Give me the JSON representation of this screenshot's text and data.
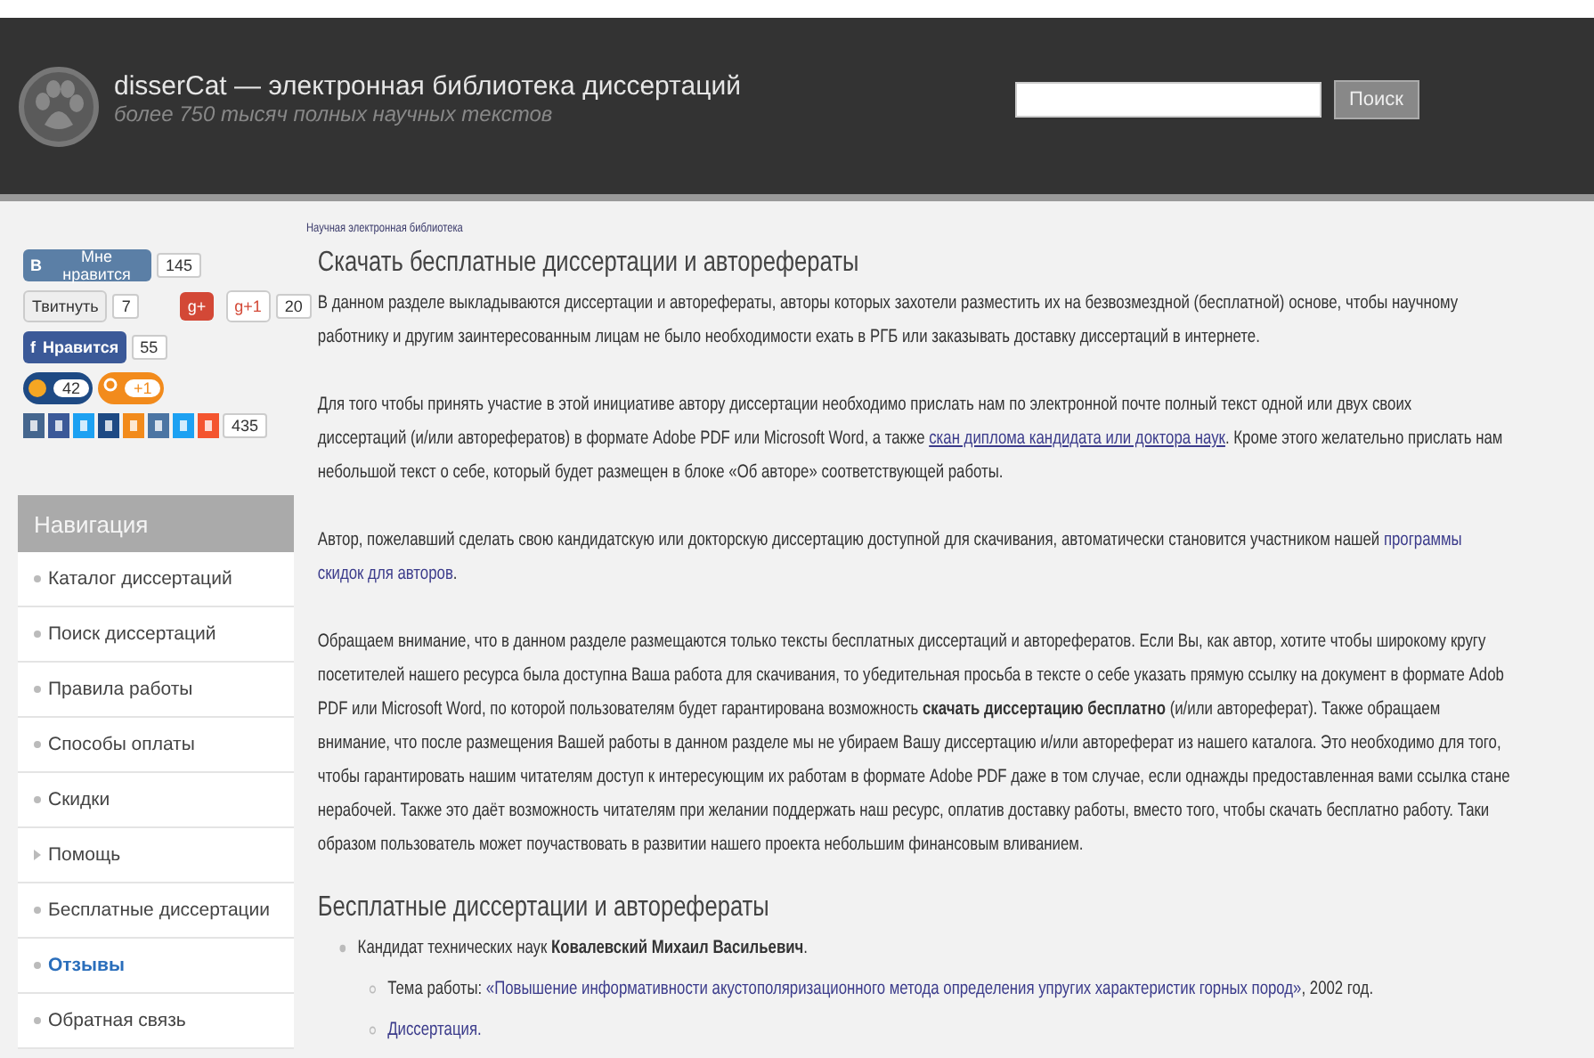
{
  "header": {
    "title": "disserCat — электронная библиотека диссертаций",
    "subtitle": "более 750 тысяч полных научных текстов",
    "search_button": "Поиск"
  },
  "social": {
    "vk": {
      "logo": "В",
      "label": "Мне нравится",
      "count": "145"
    },
    "twitter": {
      "label": "Твитнуть",
      "count": "7"
    },
    "gplus": {
      "logo": "g+",
      "label": "g+1",
      "count": "20"
    },
    "facebook": {
      "logo": "f",
      "label": "Нравится",
      "count": "55"
    },
    "mailru": {
      "count": "42"
    },
    "ok": {
      "count": "+1"
    },
    "share": {
      "count": "435"
    }
  },
  "nav": {
    "title": "Навигация",
    "items": [
      {
        "label": "Каталог диссертаций",
        "kind": "bullet",
        "selected": false
      },
      {
        "label": "Поиск диссертаций",
        "kind": "bullet",
        "selected": false
      },
      {
        "label": "Правила работы",
        "kind": "bullet",
        "selected": false
      },
      {
        "label": "Способы оплаты",
        "kind": "bullet",
        "selected": false
      },
      {
        "label": "Скидки",
        "kind": "bullet",
        "selected": false
      },
      {
        "label": "Помощь",
        "kind": "arrow",
        "selected": false
      },
      {
        "label": "Бесплатные диссертации",
        "kind": "bullet",
        "selected": false
      },
      {
        "label": "Отзывы",
        "kind": "bullet",
        "selected": true
      },
      {
        "label": "Обратная связь",
        "kind": "bullet",
        "selected": false
      }
    ]
  },
  "main": {
    "breadcrumb": "Научная электронная библиотека",
    "title": "Скачать бесплатные диссертации и авторефераты",
    "paragraphs": [
      {
        "lines": [
          [
            {
              "kind": "text",
              "text": "В данном разделе выкладываются диссертации и авторефераты, авторы которых захотели разместить их на безвозмездной (бесплатной) основе, чтобы научному"
            }
          ],
          [
            {
              "kind": "text",
              "text": "работнику и другим заинтересованным лицам не было необходимости ехать в РГБ или заказывать доставку диссертаций в интернете."
            }
          ]
        ]
      },
      {
        "lines": [
          [
            {
              "kind": "text",
              "text": "Для того чтобы принять участие в этой инициативе автору диссертации необходимо прислать нам по электронной почте полный текст одной или двух своих"
            }
          ],
          [
            {
              "kind": "text",
              "text": "диссертаций (и/или авторефератов) в формате Adobe PDF или Microsoft Word, а также "
            },
            {
              "kind": "underlined-link",
              "text": "скан диплома кандидата или доктора наук"
            },
            {
              "kind": "text",
              "text": ". Кроме этого желательно прислать нам"
            }
          ],
          [
            {
              "kind": "text",
              "text": "небольшой текст о себе, который будет размещен в блоке «Об авторе» соответствующей работы."
            }
          ]
        ]
      },
      {
        "lines": [
          [
            {
              "kind": "text",
              "text": "Автор, пожелавший сделать свою кандидатскую или докторскую диссертацию доступной для скачивания, автоматически становится участником нашей "
            },
            {
              "kind": "link",
              "text": "программы"
            }
          ],
          [
            {
              "kind": "link",
              "text": "скидок для авторов"
            },
            {
              "kind": "text",
              "text": "."
            }
          ]
        ]
      },
      {
        "lines": [
          [
            {
              "kind": "text",
              "text": "Обращаем внимание, что в данном разделе размещаются только тексты бесплатных диссертаций и авторефератов. Если Вы, как автор, хотите чтобы широкому кругу"
            }
          ],
          [
            {
              "kind": "text",
              "text": "посетителей нашего ресурса была доступна Ваша работа для скачивания, то убедительная просьба в тексте о себе указать прямую ссылку на документ в формате Adob"
            }
          ],
          [
            {
              "kind": "text",
              "text": "PDF или Microsoft Word, по которой пользователям будет гарантирована возможность **скачать диссертацию бесплатно** (и/или автореферат). Также обращаем"
            }
          ],
          [
            {
              "kind": "text",
              "text": "внимание, что после размещения Вашей работы в данном разделе мы не убираем Вашу диссертацию и/или автореферат из нашего каталога. Это необходимо для того,"
            }
          ],
          [
            {
              "kind": "text",
              "text": "чтобы гарантировать нашим читателям доступ к интересующим их работам в формате Adobe PDF даже в том случае, если однажды предоставленная вами ссылка стане"
            }
          ],
          [
            {
              "kind": "text",
              "text": "нерабочей. Также это даёт возможность читателям при желании поддержать наш ресурс, оплатив доставку работы, вместо того, чтобы скачать бесплатно работу. Таки"
            }
          ],
          [
            {
              "kind": "text",
              "text": "образом пользователь может поучаствовать в развитии нашего проекта небольшим финансовым вливанием."
            }
          ]
        ]
      }
    ],
    "section_title": "Бесплатные диссертации и авторефераты",
    "list": [
      {
        "segments": [
          {
            "kind": "text",
            "text": "Кандидат технических наук **Ковалевский Михаил Васильевич**."
          }
        ],
        "children": [
          {
            "segments": [
              {
                "kind": "text",
                "text": "Тема работы: "
              },
              {
                "kind": "link",
                "text": "«Повышение информативности акустополяризационного метода определения упругих характеристик горных пород»"
              },
              {
                "kind": "text",
                "text": ", 2002 год."
              }
            ]
          },
          {
            "segments": [
              {
                "kind": "link",
                "text": "Диссертация."
              }
            ]
          }
        ]
      }
    ]
  }
}
